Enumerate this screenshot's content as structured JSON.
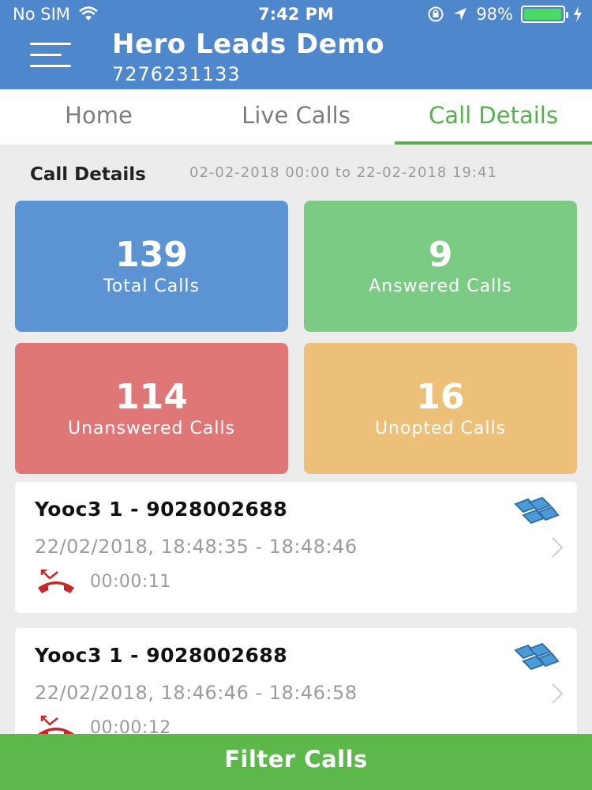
{
  "status_bar": {
    "carrier": "No SIM",
    "time": "7:42 PM",
    "battery": "98%",
    "battery_level": 0.98
  },
  "header": {
    "title": "Hero Leads Demo",
    "subtitle": "7276231133"
  },
  "tabs": [
    {
      "label": "Home",
      "active": false
    },
    {
      "label": "Live Calls",
      "active": false
    },
    {
      "label": "Call Details",
      "active": true
    }
  ],
  "section": {
    "title": "Call Details",
    "date_range": "02-02-2018 00:00 to 22-02-2018 19:41"
  },
  "stats": {
    "total": {
      "value": "139",
      "label": "Total Calls"
    },
    "answered": {
      "value": "9",
      "label": "Answered Calls"
    },
    "unanswered": {
      "value": "114",
      "label": "Unanswered Calls"
    },
    "unopted": {
      "value": "16",
      "label": "Unopted Calls"
    }
  },
  "calls": [
    {
      "name": "Yooc3 1 - 9028002688",
      "time": "22/02/2018, 18:48:35 - 18:48:46",
      "duration": "00:00:11",
      "icon": "missed-call-icon"
    },
    {
      "name": "Yooc3 1 - 9028002688",
      "time": "22/02/2018, 18:46:46 - 18:46:58",
      "duration": "00:00:12",
      "icon": "missed-call-icon"
    }
  ],
  "footer": {
    "filter_label": "Filter Calls"
  },
  "colors": {
    "header": "#4f87cc",
    "active_tab": "#55b04b",
    "total": "#5b93d3",
    "answered": "#7bcb85",
    "unanswered": "#e07777",
    "unopted": "#ecc078",
    "filter": "#5cb84a"
  }
}
